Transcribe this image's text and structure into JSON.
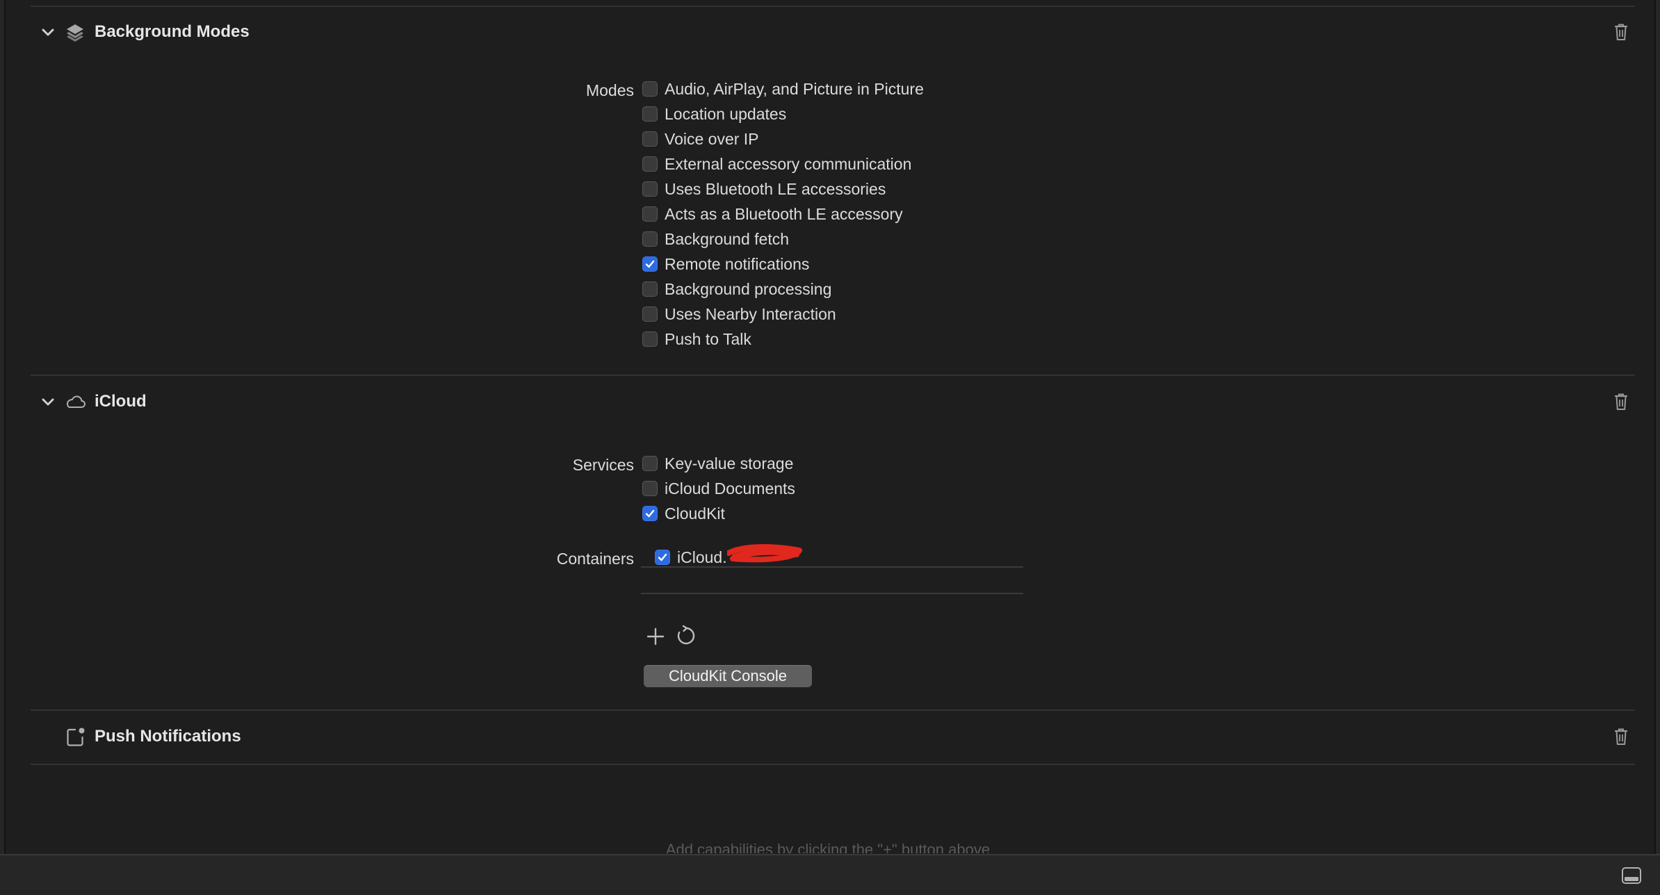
{
  "sections": {
    "background_modes": {
      "title": "Background Modes",
      "icon": "layers-icon",
      "modes_label": "Modes",
      "modes": [
        {
          "label": "Audio, AirPlay, and Picture in Picture",
          "checked": false
        },
        {
          "label": "Location updates",
          "checked": false
        },
        {
          "label": "Voice over IP",
          "checked": false
        },
        {
          "label": "External accessory communication",
          "checked": false
        },
        {
          "label": "Uses Bluetooth LE accessories",
          "checked": false
        },
        {
          "label": "Acts as a Bluetooth LE accessory",
          "checked": false
        },
        {
          "label": "Background fetch",
          "checked": false
        },
        {
          "label": "Remote notifications",
          "checked": true
        },
        {
          "label": "Background processing",
          "checked": false
        },
        {
          "label": "Uses Nearby Interaction",
          "checked": false
        },
        {
          "label": "Push to Talk",
          "checked": false
        }
      ]
    },
    "icloud": {
      "title": "iCloud",
      "icon": "cloud-icon",
      "services_label": "Services",
      "services": [
        {
          "label": "Key-value storage",
          "checked": false
        },
        {
          "label": "iCloud Documents",
          "checked": false
        },
        {
          "label": "CloudKit",
          "checked": true
        }
      ],
      "containers_label": "Containers",
      "containers": [
        {
          "label": "iCloud.",
          "checked": true
        }
      ],
      "console_button": "CloudKit Console"
    },
    "push_notifications": {
      "title": "Push Notifications",
      "icon": "notification-badge-icon"
    }
  },
  "footer_hint": "Add capabilities by clicking the \"+\" button above.",
  "colors": {
    "background": "#1e1e1e",
    "checkbox_checked": "#2f6be0",
    "redaction": "#e0281e"
  }
}
